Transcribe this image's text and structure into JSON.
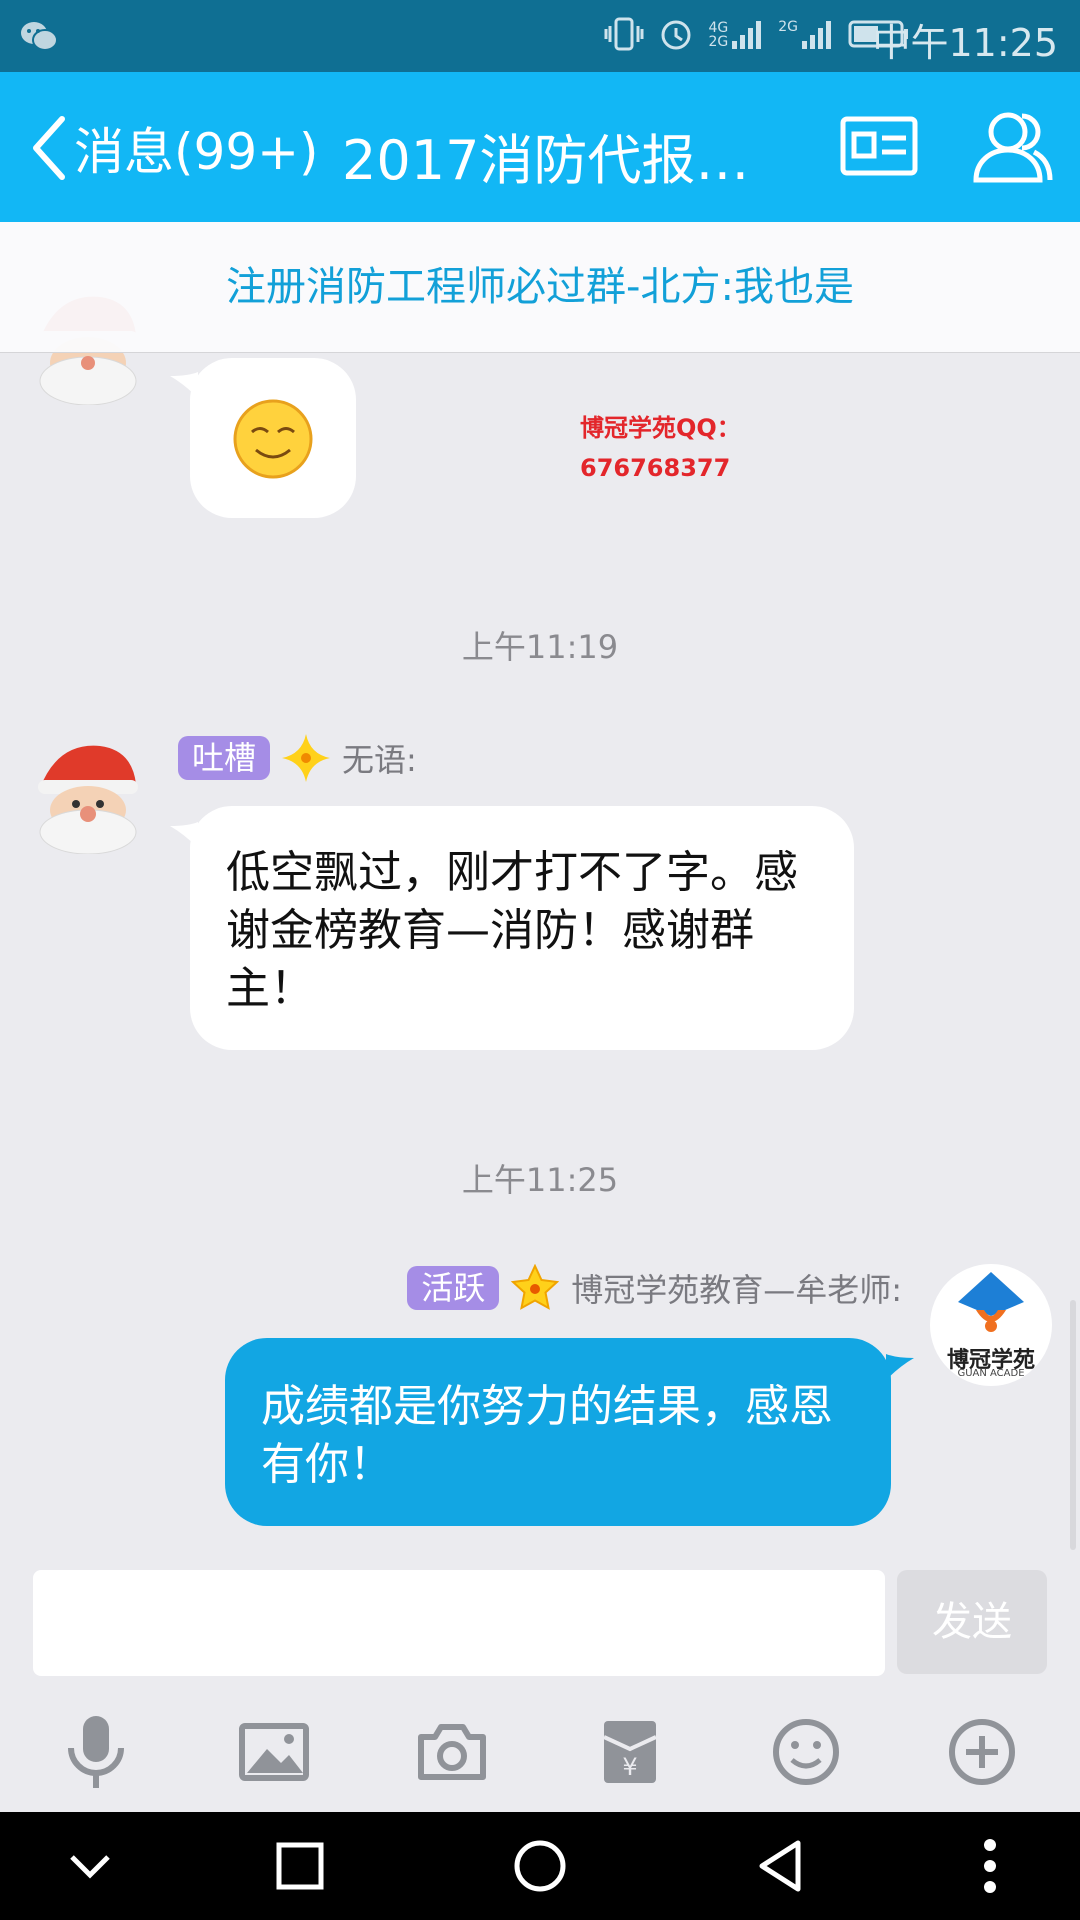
{
  "status_bar": {
    "time": "中午11:25",
    "signal_4g": "4G",
    "signal_2g": "2G",
    "signal_2g_b": "2G"
  },
  "header": {
    "back_label": "消息(99+)",
    "title": "2017消防代报…"
  },
  "banner": {
    "text": "注册消防工程师必过群-北方:我也是"
  },
  "watermark": {
    "line1": "博冠学苑QQ：",
    "line2": "676768377"
  },
  "messages": [
    {
      "timestamp": "上午11:19",
      "tag": "吐槽",
      "sender": "无语:",
      "text": "低空飘过，刚才打不了字。感谢金榜教育—消防！感谢群主！"
    },
    {
      "timestamp": "上午11:25",
      "tag": "活跃",
      "sender": "博冠学苑教育—牟老师:",
      "text": "成绩都是你努力的结果，感恩有你！",
      "avatar_text": "博冠学苑",
      "avatar_subtext": "GUAN ACADE"
    }
  ],
  "composer": {
    "send_label": "发送",
    "input_value": ""
  },
  "toolbar_icons": [
    "microphone-icon",
    "image-icon",
    "camera-icon",
    "red-packet-icon",
    "emoji-icon",
    "plus-icon"
  ],
  "colors": {
    "header": "#12b7f5",
    "status_bar": "#0f6f93",
    "outgoing_bubble": "#12a6e3",
    "tag_purple": "#a58de6"
  }
}
